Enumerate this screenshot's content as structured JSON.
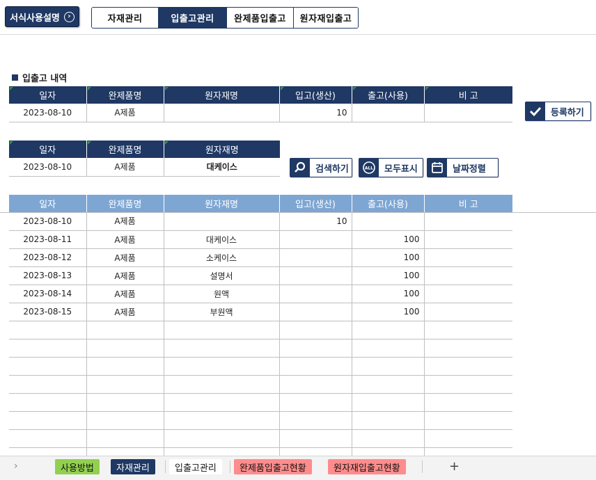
{
  "guide_button": {
    "label": "서식사용설명",
    "icon": "circle-chevron-right-icon"
  },
  "top_tabs": [
    {
      "label": "자재관리"
    },
    {
      "label": "입출고관리",
      "active": true
    },
    {
      "label": "완제품입출고"
    },
    {
      "label": "원자재입출고"
    }
  ],
  "section_title": "입출고 내역",
  "entry_table": {
    "headers": [
      "일자",
      "완제품명",
      "원자재명",
      "입고(생산)",
      "출고(사용)",
      "비 고"
    ],
    "row": [
      "2023-08-10",
      "A제품",
      "",
      "10",
      "",
      ""
    ]
  },
  "register_button": {
    "label": "등록하기",
    "icon": "checkmark-icon"
  },
  "search_table": {
    "headers": [
      "일자",
      "완제품명",
      "원자재명"
    ],
    "row": [
      "2023-08-10",
      "A제품",
      "대케이스"
    ]
  },
  "search_button": {
    "label": "검색하기",
    "icon": "magnifier-icon"
  },
  "showall_button": {
    "label": "모두표시",
    "icon": "all-circle-icon",
    "icon_text": "ALL"
  },
  "sort_button": {
    "label": "날짜정렬",
    "icon": "calendar-icon"
  },
  "list_table": {
    "headers": [
      "일자",
      "완제품명",
      "원자재명",
      "입고(생산)",
      "출고(사용)",
      "비 고"
    ],
    "rows": [
      [
        "2023-08-10",
        "A제품",
        "",
        "10",
        "",
        ""
      ],
      [
        "2023-08-11",
        "A제품",
        "대케이스",
        "",
        "100",
        ""
      ],
      [
        "2023-08-12",
        "A제품",
        "소케이스",
        "",
        "100",
        ""
      ],
      [
        "2023-08-13",
        "A제품",
        "설명서",
        "",
        "100",
        ""
      ],
      [
        "2023-08-14",
        "A제품",
        "원액",
        "",
        "100",
        ""
      ],
      [
        "2023-08-15",
        "A제품",
        "부원액",
        "",
        "100",
        ""
      ],
      [
        "",
        "",
        "",
        "",
        "",
        ""
      ],
      [
        "",
        "",
        "",
        "",
        "",
        ""
      ],
      [
        "",
        "",
        "",
        "",
        "",
        ""
      ],
      [
        "",
        "",
        "",
        "",
        "",
        ""
      ],
      [
        "",
        "",
        "",
        "",
        "",
        ""
      ],
      [
        "",
        "",
        "",
        "",
        "",
        ""
      ],
      [
        "",
        "",
        "",
        "",
        "",
        ""
      ],
      [
        "",
        "",
        "",
        "",
        "",
        ""
      ]
    ]
  },
  "sheet_tabs": [
    {
      "label": "사용방법",
      "bg": "#92d050",
      "color": "#111"
    },
    {
      "label": "자재관리",
      "bg": "#1f3864",
      "color": "#ffffff"
    },
    {
      "label": "입출고관리",
      "bg": "#ffffff",
      "color": "#111",
      "active": true
    },
    {
      "label": "완제품입출고현황",
      "bg": "#ff8c8c",
      "color": "#111"
    },
    {
      "label": "원자재입출고현황",
      "bg": "#ff8c8c",
      "color": "#111"
    }
  ],
  "sheet_nav": "›",
  "add_sheet": "+",
  "colors": {
    "navy": "#1f3864",
    "light_header": "#7ea6d3",
    "green_marker": "#2e9b3a"
  }
}
